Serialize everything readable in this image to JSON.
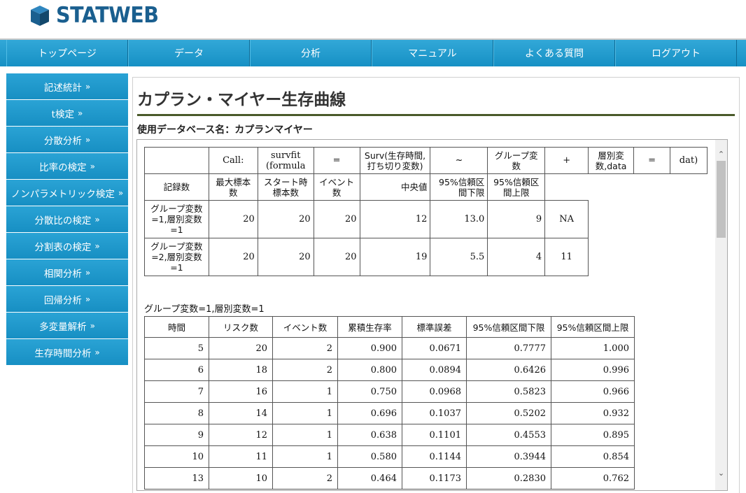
{
  "brand": {
    "name": "STATWEB"
  },
  "nav": [
    {
      "label": "トップページ"
    },
    {
      "label": "データ"
    },
    {
      "label": "分析"
    },
    {
      "label": "マニュアル"
    },
    {
      "label": "よくある質問"
    },
    {
      "label": "ログアウト"
    }
  ],
  "sidebar": [
    {
      "label": "記述統計"
    },
    {
      "label": "t検定"
    },
    {
      "label": "分散分析"
    },
    {
      "label": "比率の検定"
    },
    {
      "label": "ノンパラメトリック検定"
    },
    {
      "label": "分散比の検定"
    },
    {
      "label": "分割表の検定"
    },
    {
      "label": "相関分析"
    },
    {
      "label": "回帰分析"
    },
    {
      "label": "多変量解析"
    },
    {
      "label": "生存時間分析"
    }
  ],
  "main": {
    "title": "カプラン・マイヤー生存曲線",
    "db_label": "使用データベース名：カプランマイヤー"
  },
  "summary": {
    "row1": [
      "Call:",
      "survfit (formula",
      "=",
      "Surv(生存時間,打ち切り変数)",
      "~",
      "グループ変数",
      "+",
      "層別変数,data",
      "=",
      "dat)"
    ],
    "header": [
      "記録数",
      "最大標本数",
      "スタート時標本数",
      "イベント数",
      "中央値",
      "95%信頼区間下限",
      "95%信頼区間上限"
    ],
    "rows": [
      {
        "label": "グループ変数=1,層別変数=1",
        "values": [
          "20",
          "20",
          "20",
          "12",
          "13.0",
          "9",
          "NA"
        ]
      },
      {
        "label": "グループ変数=2,層別変数=1",
        "values": [
          "20",
          "20",
          "20",
          "19",
          "5.5",
          "4",
          "11"
        ]
      }
    ]
  },
  "detail": {
    "caption": "グループ変数=1,層別変数=1",
    "headers": [
      "時間",
      "リスク数",
      "イベント数",
      "累積生存率",
      "標準誤差",
      "95%信頼区間下限",
      "95%信頼区間上限"
    ],
    "rows": [
      [
        "5",
        "20",
        "2",
        "0.900",
        "0.0671",
        "0.7777",
        "1.000"
      ],
      [
        "6",
        "18",
        "2",
        "0.800",
        "0.0894",
        "0.6426",
        "0.996"
      ],
      [
        "7",
        "16",
        "1",
        "0.750",
        "0.0968",
        "0.5823",
        "0.966"
      ],
      [
        "8",
        "14",
        "1",
        "0.696",
        "0.1037",
        "0.5202",
        "0.932"
      ],
      [
        "9",
        "12",
        "1",
        "0.638",
        "0.1101",
        "0.4553",
        "0.895"
      ],
      [
        "10",
        "11",
        "1",
        "0.580",
        "0.1144",
        "0.3944",
        "0.854"
      ],
      [
        "13",
        "10",
        "2",
        "0.464",
        "0.1173",
        "0.2830",
        "0.762"
      ]
    ]
  },
  "colors": {
    "nav": "#1f9bd0",
    "title_rule": "#4a5a2a",
    "logo": "#1a5f8f"
  }
}
